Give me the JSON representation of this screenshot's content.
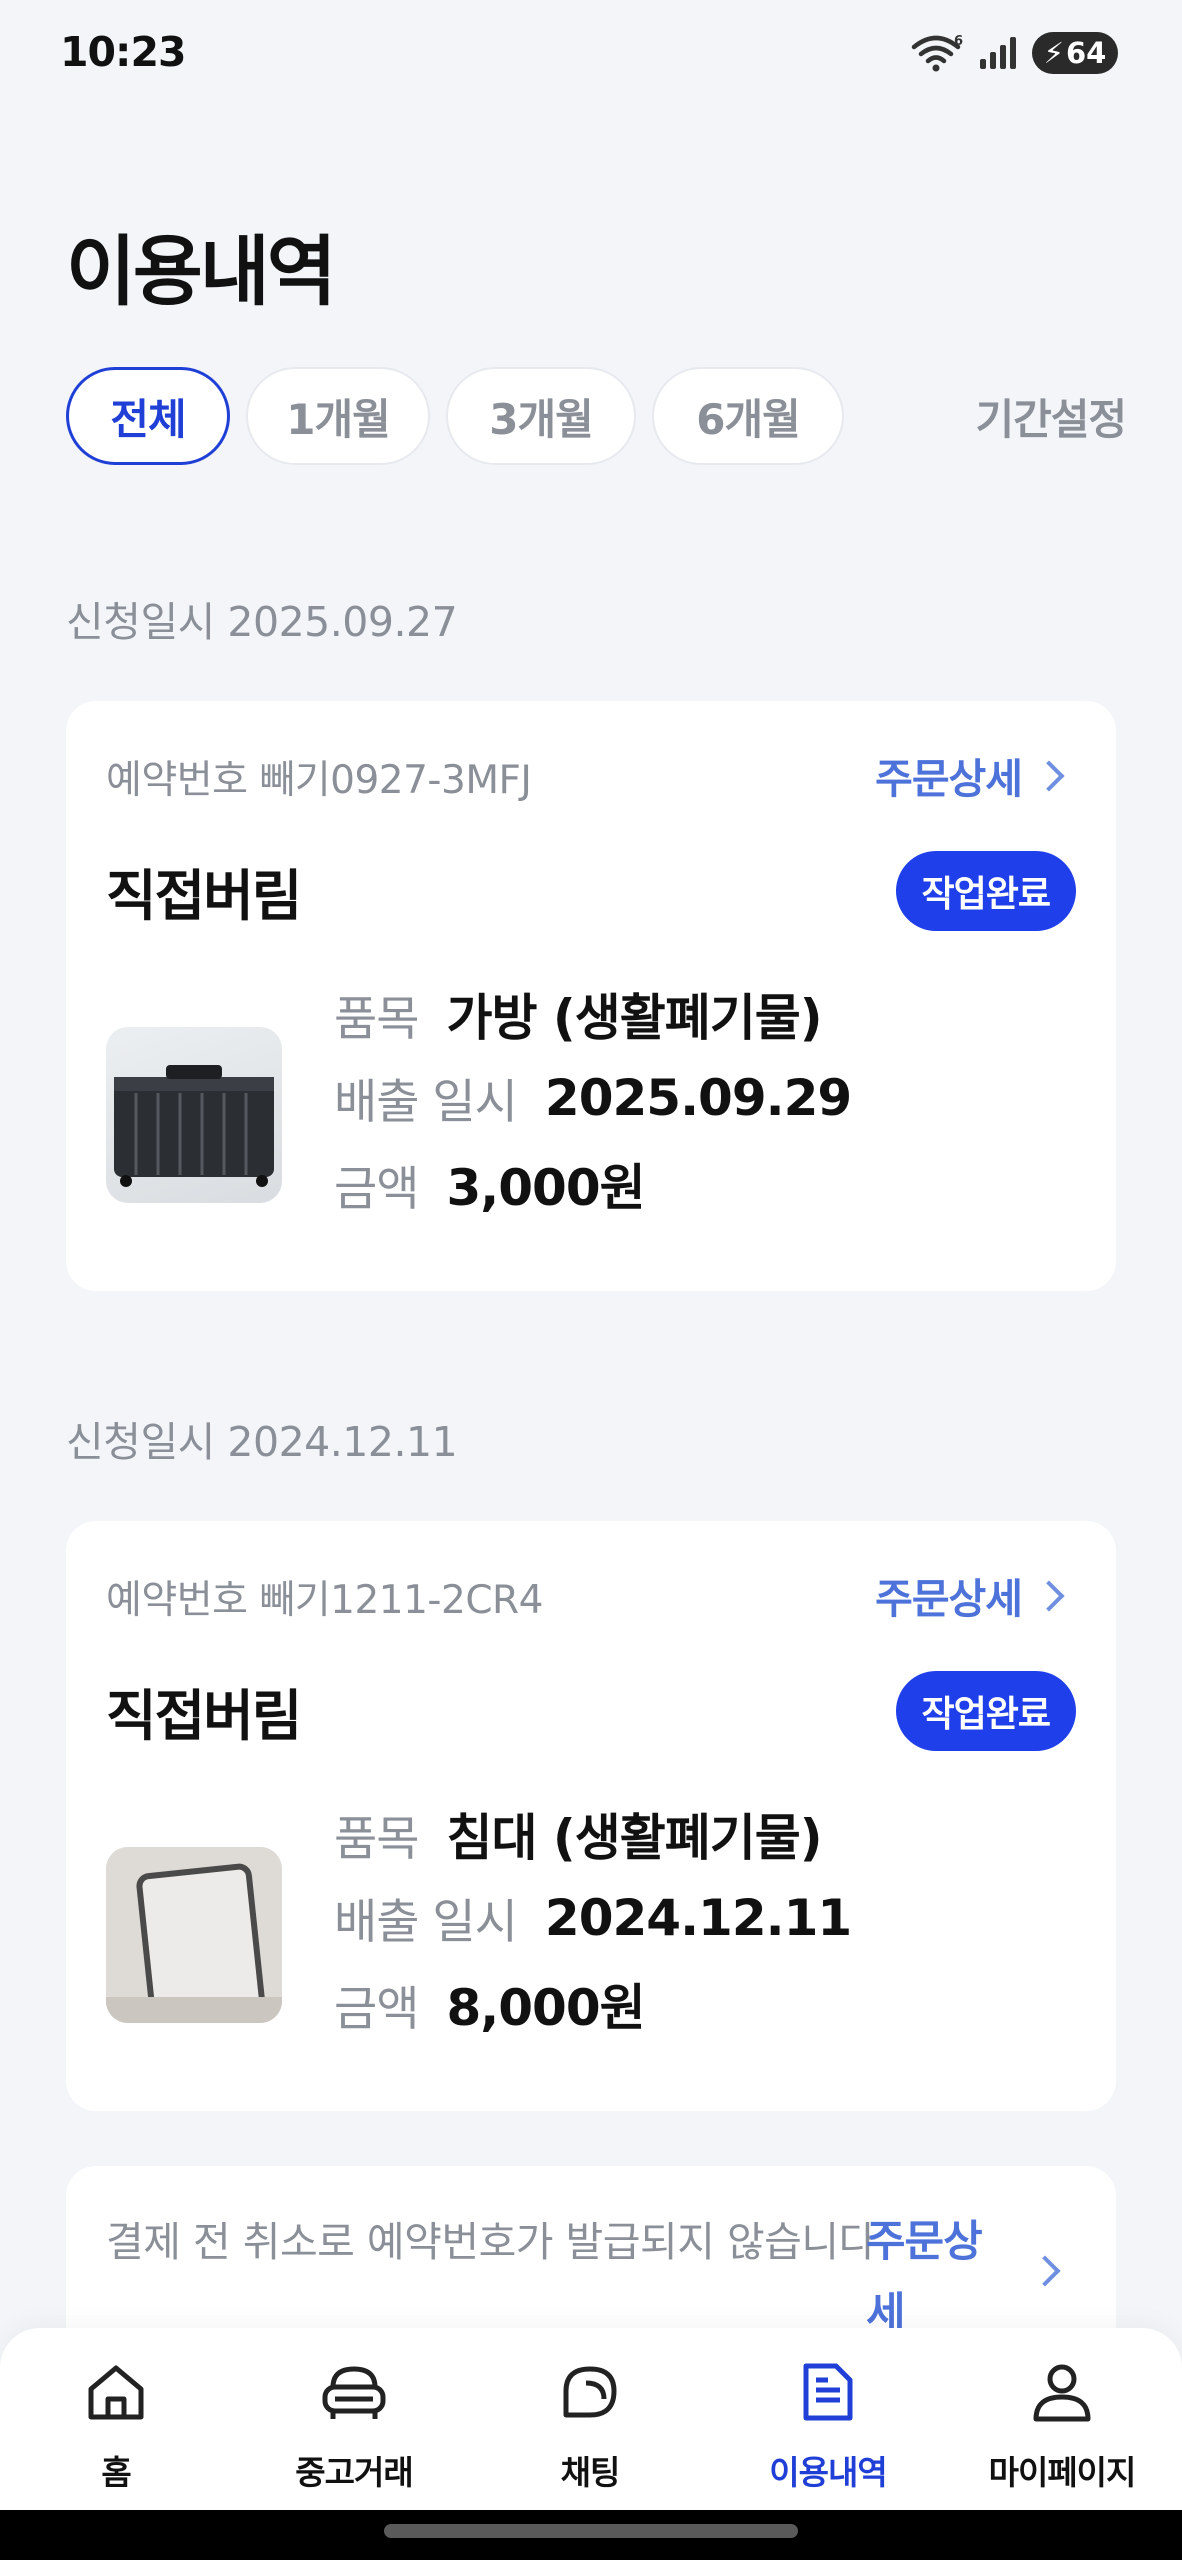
{
  "status_bar": {
    "time": "10:23",
    "battery": "64",
    "wifi_badge": "6"
  },
  "page": {
    "title": "이용내역"
  },
  "filters": {
    "chips": [
      "전체",
      "1개월",
      "3개월",
      "6개월"
    ],
    "active_index": 0,
    "period_setting": "기간설정"
  },
  "orders": [
    {
      "date_label": "신청일시 2025.09.27",
      "reservation": "예약번호 빼기0927-3MFJ",
      "detail_link": "주문상세",
      "type": "직접버림",
      "status": "작업완료",
      "image_icon": "bag-photo",
      "item_label": "품목",
      "item_value": "가방 (생활폐기물)",
      "date_out_label": "배출 일시",
      "date_out_value": "2025.09.29",
      "price_label": "금액",
      "price_value": "3,000원"
    },
    {
      "date_label": "신청일시 2024.12.11",
      "reservation": "예약번호 빼기1211-2CR4",
      "detail_link": "주문상세",
      "type": "직접버림",
      "status": "작업완료",
      "image_icon": "mattress-photo",
      "item_label": "품목",
      "item_value": "침대 (생활폐기물)",
      "date_out_label": "배출 일시",
      "date_out_value": "2024.12.11",
      "price_label": "금액",
      "price_value": "8,000원"
    }
  ],
  "pending": {
    "text": "결제 전 취소로 예약번호가 발급되지 않습니다",
    "detail_link": "주문상세"
  },
  "bottom_nav": {
    "items": [
      {
        "label": "홈",
        "icon": "home-icon"
      },
      {
        "label": "중고거래",
        "icon": "sofa-icon"
      },
      {
        "label": "채팅",
        "icon": "chat-icon"
      },
      {
        "label": "이용내역",
        "icon": "document-icon"
      },
      {
        "label": "마이페이지",
        "icon": "person-icon"
      }
    ],
    "active_index": 3
  },
  "colors": {
    "accent": "#1f3fd6",
    "badge": "#1f3fea",
    "link": "#4d72d9",
    "muted": "#8a8f98",
    "background": "#f3f5f9"
  }
}
